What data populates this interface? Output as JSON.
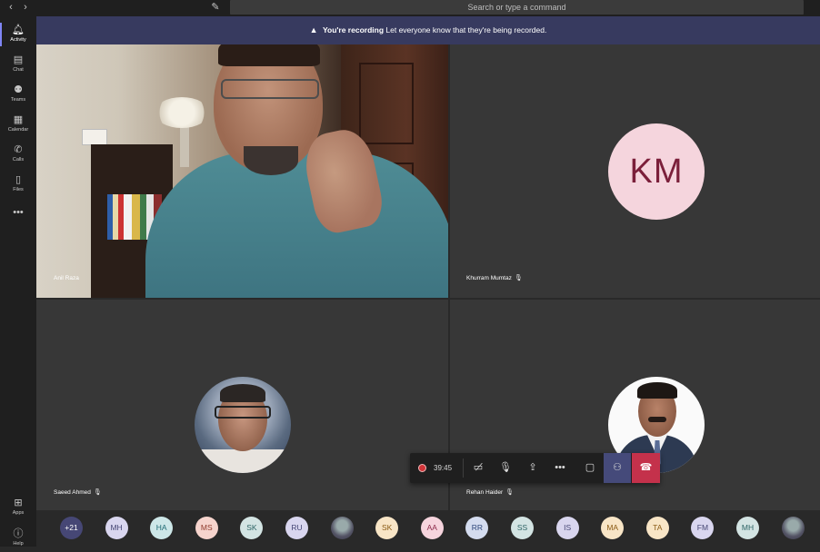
{
  "topbar": {
    "back_icon": "chevron-left-icon",
    "forward_icon": "chevron-right-icon",
    "compose_icon": "compose-icon",
    "search_placeholder": "Search or type a command"
  },
  "rail": {
    "items": [
      {
        "label": "Activity",
        "icon": "bell-icon",
        "active": true
      },
      {
        "label": "Chat",
        "icon": "chat-icon"
      },
      {
        "label": "Teams",
        "icon": "teams-icon"
      },
      {
        "label": "Calendar",
        "icon": "calendar-icon"
      },
      {
        "label": "Calls",
        "icon": "phone-icon"
      },
      {
        "label": "Files",
        "icon": "file-icon"
      }
    ],
    "more_icon": "ellipsis-icon",
    "bottom": [
      {
        "label": "Apps",
        "icon": "apps-icon"
      },
      {
        "label": "Help",
        "icon": "help-icon"
      }
    ]
  },
  "recording_banner": {
    "title": "You're recording",
    "message": "Let everyone know that they're being recorded."
  },
  "tiles": [
    {
      "name": "Anil Raza",
      "type": "video",
      "muted": false
    },
    {
      "name": "Khurram Mumtaz",
      "type": "initials",
      "initials": "KM",
      "muted": true
    },
    {
      "name": "Saeed Ahmed",
      "type": "photo",
      "muted": true
    },
    {
      "name": "Rehan Haider",
      "type": "photo",
      "muted": true
    }
  ],
  "callbar": {
    "recording_time": "39:45",
    "buttons": [
      "camera-off-icon",
      "mic-off-icon",
      "share-screen-icon",
      "more-icon",
      "chat-icon",
      "participants-icon",
      "hang-up-icon"
    ]
  },
  "participants_strip": [
    {
      "label": "+21",
      "bg": "#464775",
      "fg": "#ffffff"
    },
    {
      "label": "MH",
      "bg": "#d9d6ef",
      "fg": "#464775"
    },
    {
      "label": "HA",
      "bg": "#cde7e8",
      "fg": "#1f6b74"
    },
    {
      "label": "MS",
      "bg": "#f6d4cd",
      "fg": "#8f3a2c"
    },
    {
      "label": "SK",
      "bg": "#d3e4e3",
      "fg": "#2c6364"
    },
    {
      "label": "RU",
      "bg": "#d9d6ef",
      "fg": "#464775"
    },
    {
      "label": "",
      "photo": true
    },
    {
      "label": "SK",
      "bg": "#f8e5c6",
      "fg": "#8a5a14"
    },
    {
      "label": "AA",
      "bg": "#f6d4dd",
      "fg": "#8c2a4a"
    },
    {
      "label": "RR",
      "bg": "#d4dcef",
      "fg": "#2d4679"
    },
    {
      "label": "SS",
      "bg": "#d3e4e3",
      "fg": "#2c6364"
    },
    {
      "label": "IS",
      "bg": "#d9d6ef",
      "fg": "#464775"
    },
    {
      "label": "MA",
      "bg": "#f8e5c6",
      "fg": "#8a5a14"
    },
    {
      "label": "TA",
      "bg": "#f8e5c6",
      "fg": "#8a5a14"
    },
    {
      "label": "FM",
      "bg": "#d9d6ef",
      "fg": "#464775"
    },
    {
      "label": "MH",
      "bg": "#d3e4e3",
      "fg": "#2c6364"
    },
    {
      "label": "",
      "photo": true
    }
  ]
}
